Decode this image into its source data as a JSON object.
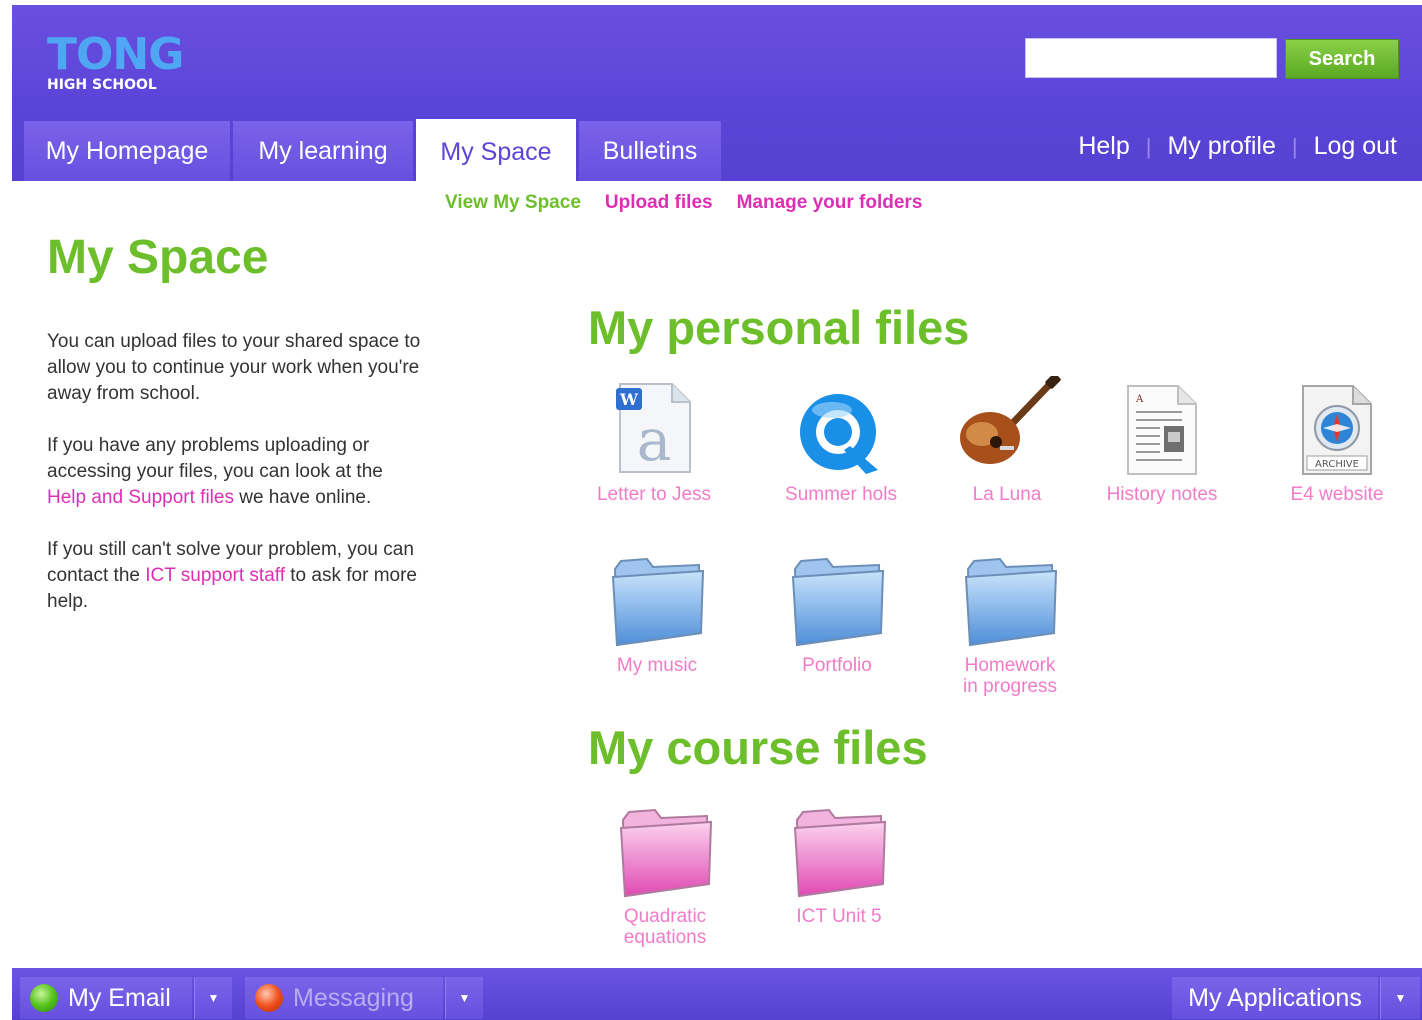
{
  "header": {
    "logo_main": "TONG",
    "logo_sub": "HIGH SCHOOL",
    "search_value": "",
    "search_button": "Search"
  },
  "nav": {
    "tabs": [
      {
        "label": "My Homepage",
        "active": false
      },
      {
        "label": "My learning",
        "active": false
      },
      {
        "label": "My Space",
        "active": true
      },
      {
        "label": "Bulletins",
        "active": false
      }
    ],
    "links": [
      "Help",
      "My profile",
      "Log out"
    ]
  },
  "subnav": {
    "current": "View My Space",
    "links": [
      "Upload files",
      "Manage your folders"
    ]
  },
  "page": {
    "title": "My Space",
    "para1": "You can upload files to your shared space to allow you to continue your work when you're away from school.",
    "para2_before": "If you have any problems uploading or accessing your files, you can look at the ",
    "para2_link": "Help and Support files",
    "para2_after": " we have online.",
    "para3_before": "If you still can't solve your problem, you can contact the ",
    "para3_link": "ICT support staff",
    "para3_after": " to ask for more help."
  },
  "personal": {
    "title": "My personal files",
    "files": [
      {
        "label": "Letter to Jess",
        "icon": "word-document-icon"
      },
      {
        "label": "Summer hols",
        "icon": "quicktime-icon"
      },
      {
        "label": "La Luna",
        "icon": "guitar-icon"
      },
      {
        "label": "History notes",
        "icon": "newspaper-document-icon"
      },
      {
        "label": "E4 website",
        "icon": "archive-icon",
        "badge": "ARCHIVE"
      }
    ],
    "folders": [
      {
        "label": "My music",
        "icon": "blue-folder-icon"
      },
      {
        "label": "Portfolio",
        "icon": "blue-folder-icon"
      },
      {
        "label": "Homework in progress",
        "icon": "blue-folder-icon"
      }
    ]
  },
  "course": {
    "title": "My course files",
    "folders": [
      {
        "label": "Quadratic equations",
        "icon": "pink-folder-icon"
      },
      {
        "label": "ICT Unit 5",
        "icon": "pink-folder-icon"
      }
    ]
  },
  "bottom": {
    "email": "My Email",
    "messaging": "Messaging",
    "applications": "My Applications"
  },
  "colors": {
    "header": "#5b45d8",
    "accent_green": "#6cbf2a",
    "link_pink": "#dd2fb3",
    "logo_blue": "#4fa6f2"
  }
}
